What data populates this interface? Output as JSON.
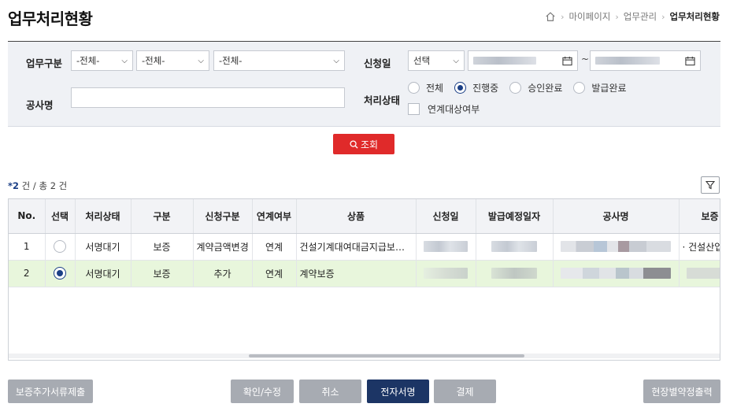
{
  "header": {
    "title": "업무처리현황",
    "breadcrumb": [
      "마이페이지",
      "업무관리",
      "업무처리현황"
    ]
  },
  "search": {
    "business_type_label": "업무구분",
    "business_type_1": "-전체-",
    "business_type_2": "-전체-",
    "business_type_3": "-전체-",
    "apply_date_label": "신청일",
    "apply_date_select": "선택",
    "date_sep": "~",
    "project_name_label": "공사명",
    "project_name_value": "",
    "status_label": "처리상태",
    "status_options": [
      {
        "label": "전체",
        "selected": false
      },
      {
        "label": "진행중",
        "selected": true
      },
      {
        "label": "승인완료",
        "selected": false
      },
      {
        "label": "발급완료",
        "selected": false
      }
    ],
    "linked_checkbox_label": "연계대상여부",
    "linked_checked": false,
    "search_button": "조회"
  },
  "result": {
    "count_prefix": "*",
    "count_num": "2",
    "count_text": " 건 / 총 2 건"
  },
  "table": {
    "columns": [
      "No.",
      "선택",
      "처리상태",
      "구분",
      "신청구분",
      "연계여부",
      "상품",
      "신청일",
      "발급예정일자",
      "공사명",
      "보증"
    ],
    "rows": [
      {
        "no": "1",
        "selected": false,
        "status": "서명대기",
        "type": "보증",
        "apply_type": "계약금액변경",
        "linked": "연계",
        "product": "건설기계대여대금지급보…",
        "guarantor": "· 건설산업기"
      },
      {
        "no": "2",
        "selected": true,
        "status": "서명대기",
        "type": "보증",
        "apply_type": "추가",
        "linked": "연계",
        "product": "계약보증",
        "guarantor": ""
      }
    ]
  },
  "buttons": {
    "add_docs": "보증추가서류제출",
    "confirm_edit": "확인/수정",
    "cancel": "취소",
    "e_sign": "전자서명",
    "payment": "결제",
    "site_print": "현장별약정출력"
  },
  "colors": {
    "primary_navy": "#1c3565",
    "search_red": "#e02a2a",
    "selected_row": "#e8f6dc",
    "disabled_gray": "#a7abb2"
  }
}
